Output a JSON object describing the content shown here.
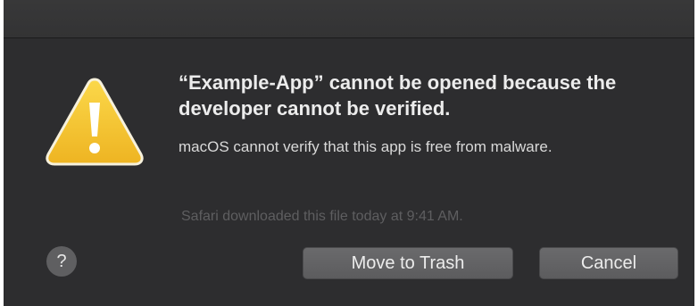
{
  "dialog": {
    "title": "“Example-App” cannot be opened because the developer cannot be verified.",
    "message": "macOS cannot verify that this app is free from malware.",
    "download_info": "Safari downloaded this file today at 9:41 AM.",
    "icon": "warning-icon",
    "help_label": "?",
    "buttons": {
      "move_to_trash": "Move to Trash",
      "cancel": "Cancel"
    }
  },
  "colors": {
    "background": "#2d2d2f",
    "warning_yellow": "#f5c531",
    "button": "#636365"
  }
}
